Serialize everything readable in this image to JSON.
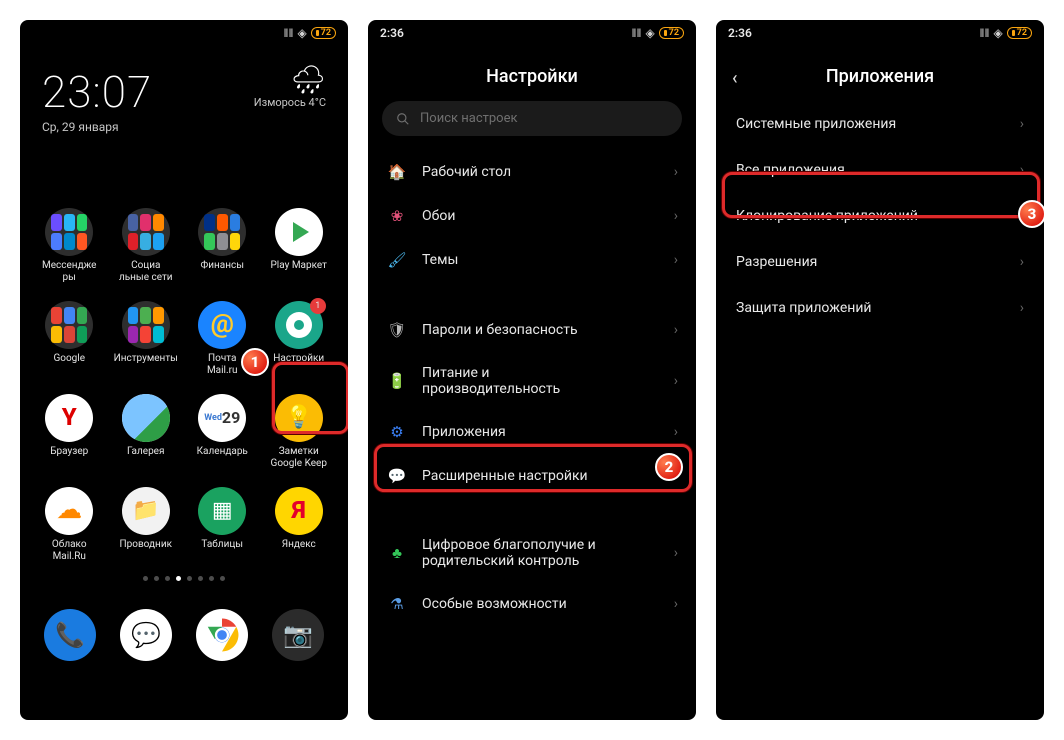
{
  "status": {
    "time_home": "",
    "time_s": "2:36",
    "battery": "72"
  },
  "home": {
    "clock": "23:07",
    "date": "Ср, 29 января",
    "weather_label": "Изморось  4°C",
    "calendar_wd": "Wed",
    "calendar_dy": "29",
    "apps": {
      "messengers": "Мессендже\nры",
      "social": "Социа\nльные сети",
      "finance": "Финансы",
      "play": "Play Маркет",
      "google": "Google",
      "tools": "Инструменты",
      "mailru": "Почта\nMail.ru",
      "settings": "Настройки",
      "browser": "Браузер",
      "gallery": "Галерея",
      "calendar": "Календарь",
      "keep": "Заметки\nGoogle Keep",
      "cloud": "Облако\nMail.Ru",
      "fm": "Проводник",
      "sheets": "Таблицы",
      "yandex": "Яндекс"
    },
    "settings_badge": "1"
  },
  "settings": {
    "title": "Настройки",
    "search_placeholder": "Поиск настроек",
    "items": [
      {
        "icon": "🏠",
        "color": "#3a7ff5",
        "label": "Рабочий стол"
      },
      {
        "icon": "❀",
        "color": "#e25179",
        "label": "Обои"
      },
      {
        "icon": "🖌",
        "color": "#4bb9ef",
        "label": "Темы"
      },
      {
        "icon": "🛡",
        "color": "#b8b8b8",
        "label": "Пароли и безопасность",
        "gap_before": true
      },
      {
        "icon": "🔋",
        "color": "#34c759",
        "label": "Питание и\nпроизводительность"
      },
      {
        "icon": "⚙",
        "color": "#3a7ff5",
        "label": "Приложения",
        "highlight": true
      },
      {
        "icon": "💬",
        "color": "#b8b8b8",
        "label": "Расширенные настройки"
      },
      {
        "icon": "♣",
        "color": "#34c759",
        "label": "Цифровое благополучие и\nродительский контроль",
        "gap_before": true
      },
      {
        "icon": "⚗",
        "color": "#5b9de5",
        "label": "Особые возможности"
      }
    ]
  },
  "apps_page": {
    "title": "Приложения",
    "items": [
      {
        "label": "Системные приложения"
      },
      {
        "label": "Все приложения",
        "highlight": true
      },
      {
        "label": "Клонирование приложений"
      },
      {
        "label": "Разрешения"
      },
      {
        "label": "Защита приложений"
      }
    ]
  },
  "callouts": {
    "n1": "1",
    "n2": "2",
    "n3": "3"
  }
}
